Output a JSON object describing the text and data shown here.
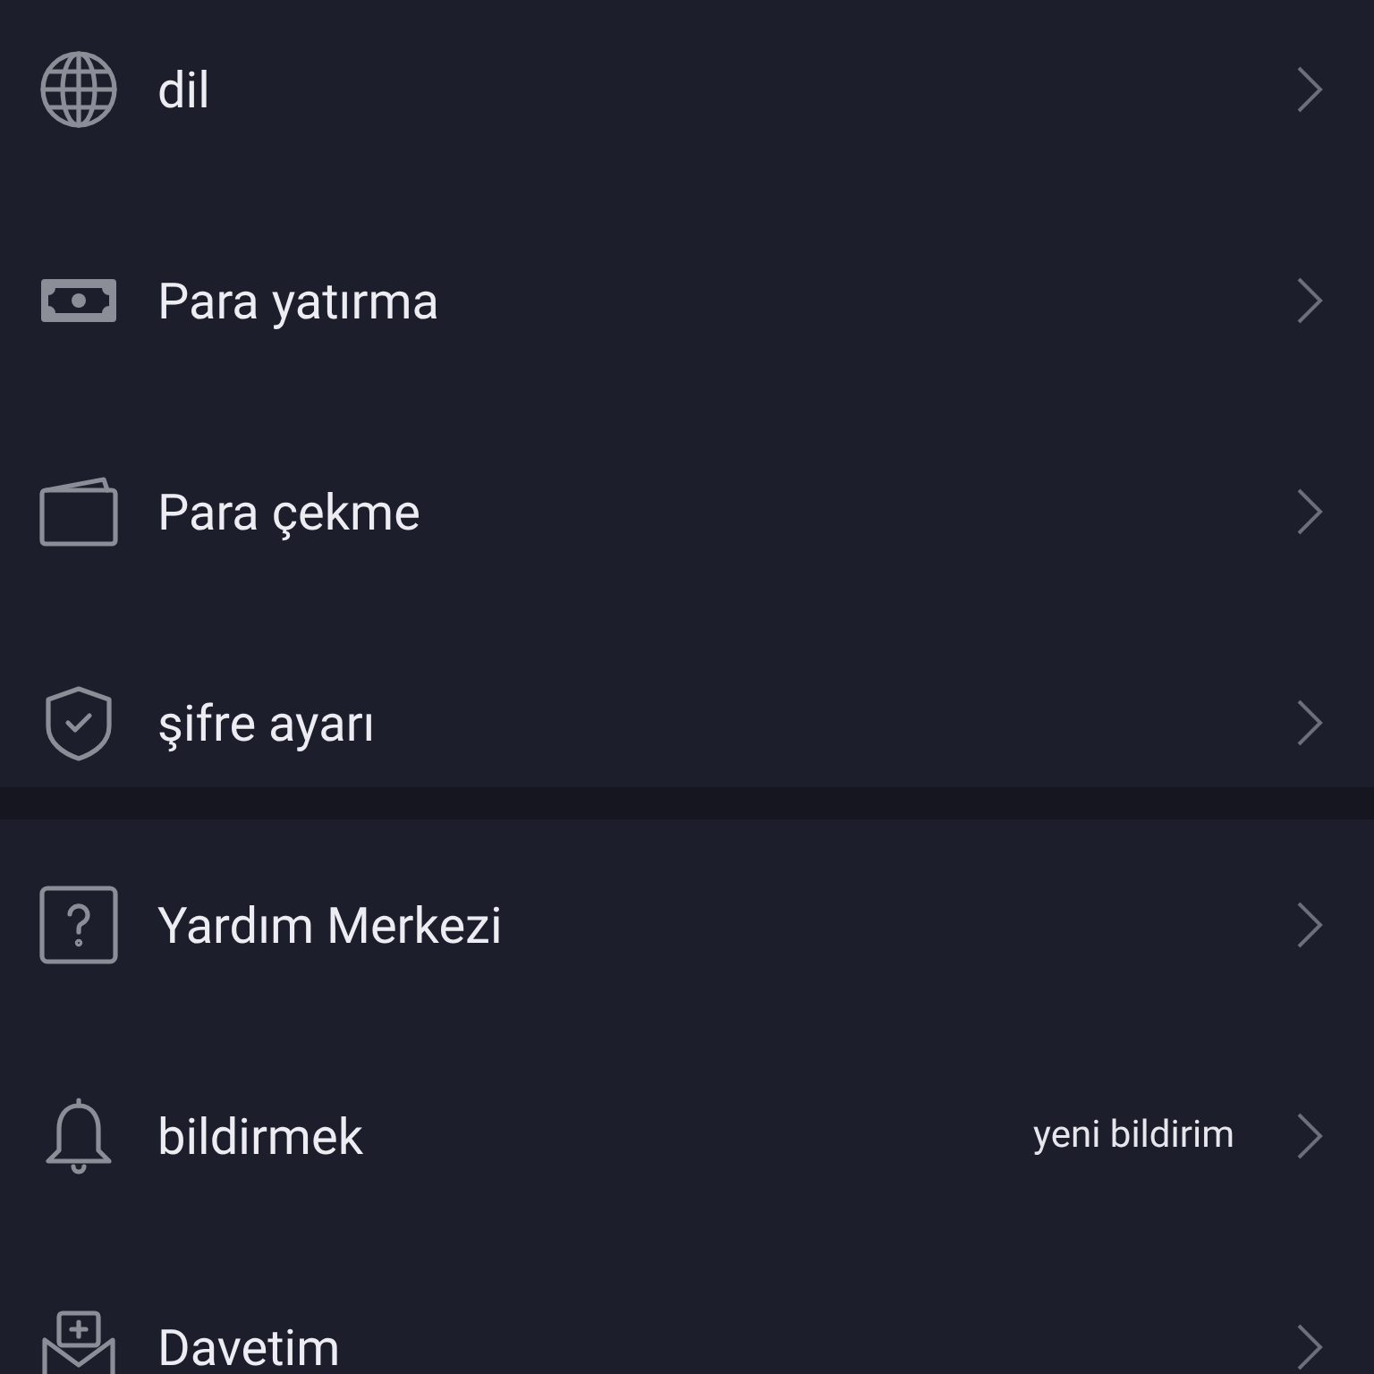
{
  "sections": [
    {
      "items": [
        {
          "label": "dil"
        },
        {
          "label": "Para yatırma"
        },
        {
          "label": "Para çekme"
        },
        {
          "label": "şifre ayarı"
        }
      ]
    },
    {
      "items": [
        {
          "label": "Yardım Merkezi"
        },
        {
          "label": "bildirmek",
          "value": "yeni bildirim"
        },
        {
          "label": "Davetim"
        }
      ]
    }
  ]
}
